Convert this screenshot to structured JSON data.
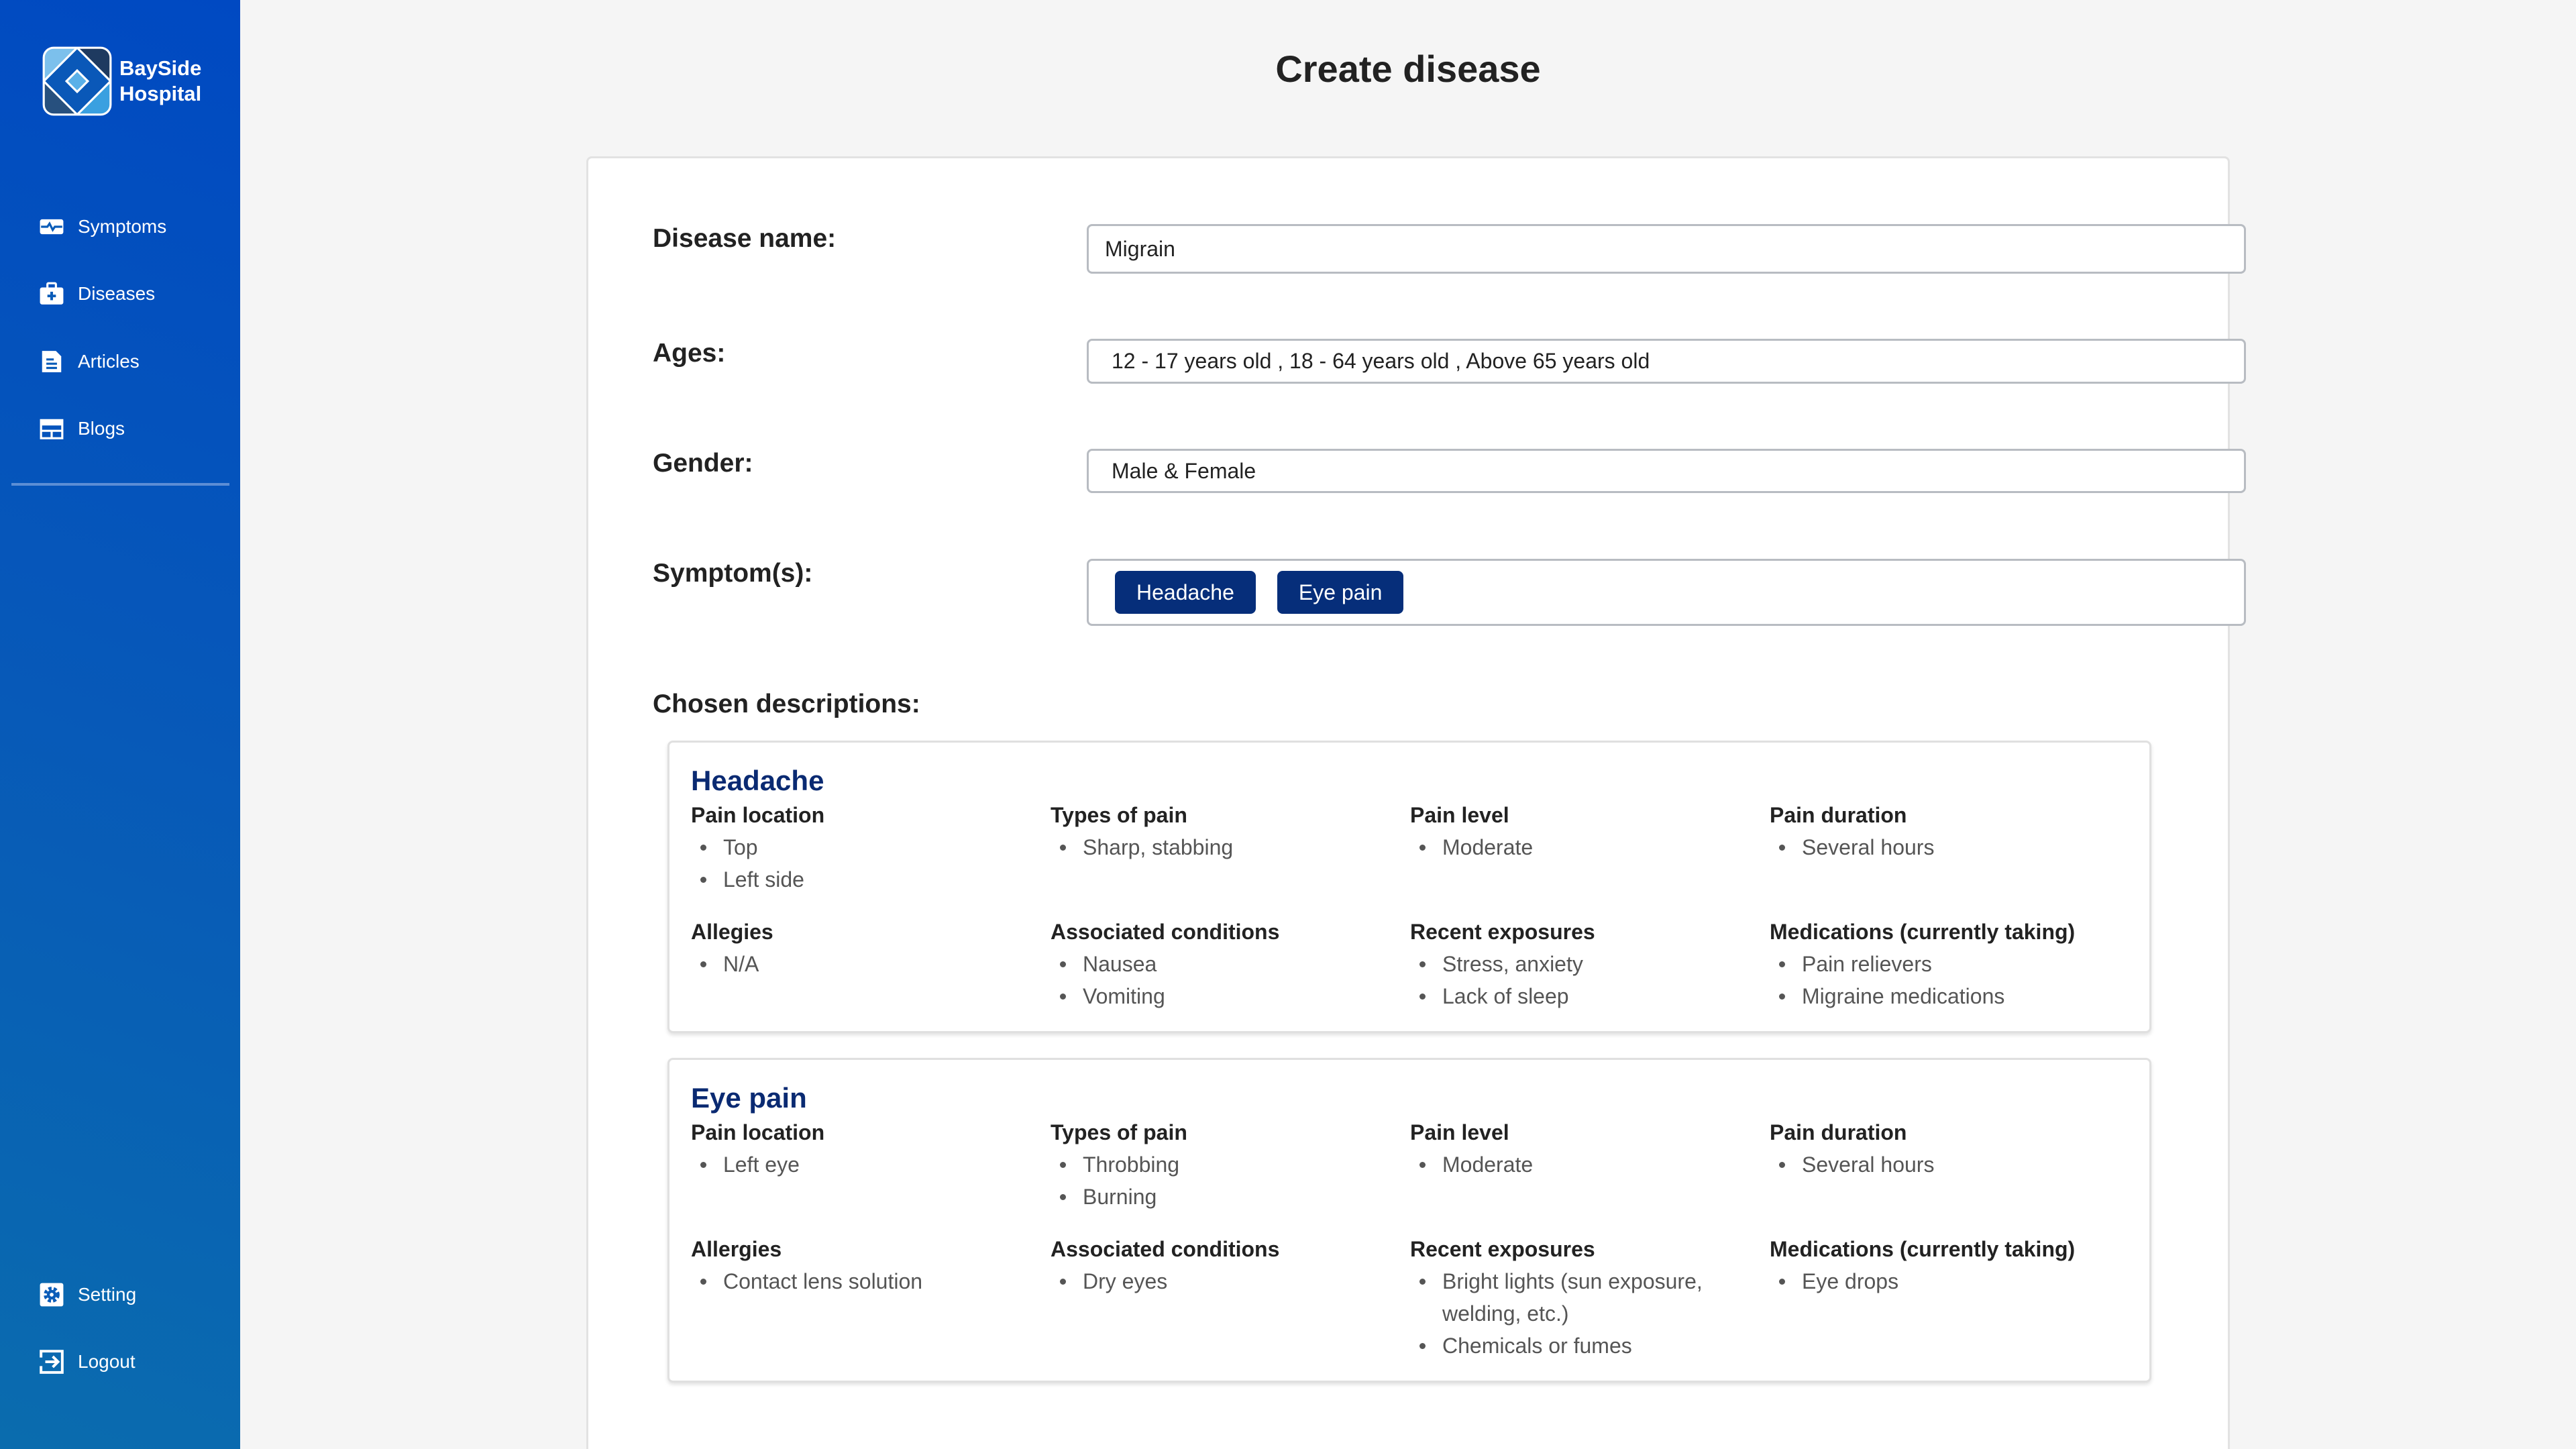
{
  "brand": {
    "line1": "BaySide",
    "line2": "Hospital"
  },
  "nav": [
    {
      "label": "Symptoms",
      "icon": "heartbeat-icon"
    },
    {
      "label": "Diseases",
      "icon": "medical-kit-icon"
    },
    {
      "label": "Articles",
      "icon": "document-icon"
    },
    {
      "label": "Blogs",
      "icon": "newspaper-icon"
    }
  ],
  "nav_bottom": [
    {
      "label": "Setting",
      "icon": "gear-icon"
    },
    {
      "label": "Logout",
      "icon": "logout-icon"
    }
  ],
  "page_title": "Create disease",
  "form": {
    "disease_name": {
      "label": "Disease name:",
      "value": "Migrain"
    },
    "ages": {
      "label": "Ages:",
      "value": "12 - 17 years old , 18 - 64 years old , Above 65 years old"
    },
    "gender": {
      "label": "Gender:",
      "value": "Male & Female"
    },
    "symptoms": {
      "label": "Symptom(s):",
      "chips": [
        "Headache",
        "Eye pain"
      ]
    }
  },
  "chosen_label": "Chosen descriptions:",
  "descriptions": [
    {
      "title": "Headache",
      "sections": [
        {
          "heading": "Pain location",
          "items": [
            "Top",
            "Left side"
          ]
        },
        {
          "heading": "Types of pain",
          "items": [
            "Sharp, stabbing"
          ]
        },
        {
          "heading": "Pain level",
          "items": [
            "Moderate"
          ]
        },
        {
          "heading": "Pain duration",
          "items": [
            "Several hours"
          ]
        },
        {
          "heading": "Allegies",
          "items": [
            "N/A"
          ]
        },
        {
          "heading": "Associated conditions",
          "items": [
            "Nausea",
            "Vomiting"
          ]
        },
        {
          "heading": "Recent exposures",
          "items": [
            "Stress, anxiety",
            "Lack of sleep"
          ]
        },
        {
          "heading": "Medications (currently taking)",
          "items": [
            "Pain relievers",
            "Migraine medications"
          ]
        }
      ]
    },
    {
      "title": "Eye pain",
      "sections": [
        {
          "heading": "Pain location",
          "items": [
            "Left eye"
          ]
        },
        {
          "heading": "Types of pain",
          "items": [
            "Throbbing",
            "Burning"
          ]
        },
        {
          "heading": "Pain level",
          "items": [
            "Moderate"
          ]
        },
        {
          "heading": "Pain duration",
          "items": [
            "Several hours"
          ]
        },
        {
          "heading": "Allergies",
          "items": [
            "Contact lens solution"
          ]
        },
        {
          "heading": "Associated conditions",
          "items": [
            "Dry eyes"
          ]
        },
        {
          "heading": "Recent exposures",
          "items": [
            "Bright lights (sun exposure, welding, etc.)",
            "Chemicals or fumes"
          ]
        },
        {
          "heading": "Medications (currently taking)",
          "items": [
            "Eye drops"
          ]
        }
      ]
    }
  ]
}
